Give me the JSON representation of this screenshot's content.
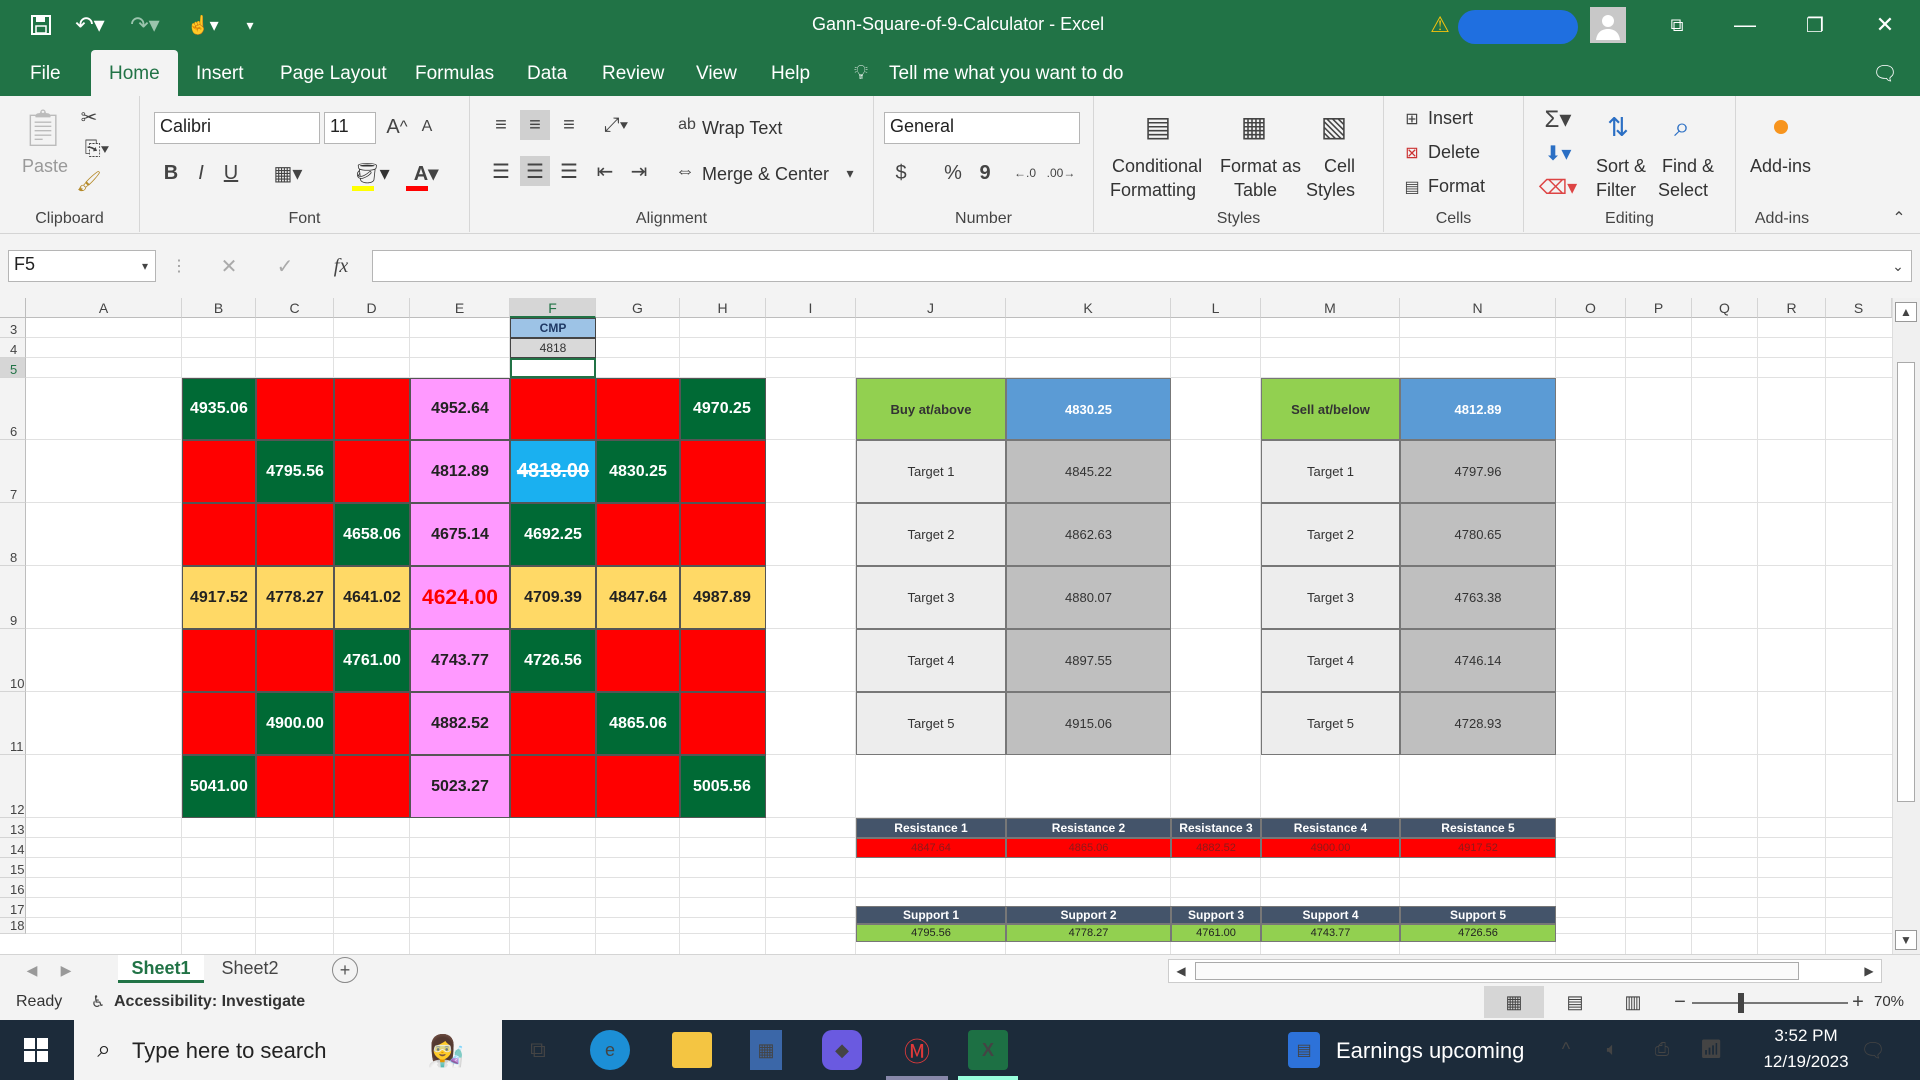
{
  "app": {
    "title": "Gann-Square-of-9-Calculator  -  Excel"
  },
  "tabs": [
    "File",
    "Home",
    "Insert",
    "Page Layout",
    "Formulas",
    "Data",
    "Review",
    "View",
    "Help"
  ],
  "tellme": "Tell me what you want to do",
  "ribbon": {
    "clipboard": {
      "paste": "Paste",
      "label": "Clipboard"
    },
    "font": {
      "name": "Calibri",
      "size": "11",
      "label": "Font",
      "bold": "B",
      "italic": "I",
      "underline": "U"
    },
    "alignment": {
      "wrap": "Wrap Text",
      "merge": "Merge & Center",
      "label": "Alignment"
    },
    "number": {
      "format": "General",
      "label": "Number",
      "currency": "$",
      "percent": "%",
      "comma": "9"
    },
    "styles": {
      "cond1": "Conditional",
      "cond2": "Formatting",
      "fmt1": "Format as",
      "fmt2": "Table",
      "cell1": "Cell",
      "cell2": "Styles",
      "label": "Styles"
    },
    "cells": {
      "insert": "Insert",
      "delete": "Delete",
      "format": "Format",
      "label": "Cells"
    },
    "editing": {
      "sort1": "Sort &",
      "sort2": "Filter",
      "find1": "Find &",
      "find2": "Select",
      "label": "Editing"
    },
    "addins": {
      "btn": "Add-ins",
      "label": "Add-ins"
    }
  },
  "formula_bar": {
    "name_box": "F5",
    "fx": "fx",
    "value": ""
  },
  "columns": [
    "A",
    "B",
    "C",
    "D",
    "E",
    "F",
    "G",
    "H",
    "I",
    "J",
    "K",
    "L",
    "M",
    "N",
    "O",
    "P",
    "Q",
    "R",
    "S"
  ],
  "rows": [
    "3",
    "4",
    "5",
    "6",
    "7",
    "8",
    "9",
    "10",
    "11",
    "12",
    "13",
    "14",
    "15",
    "16",
    "17",
    "18"
  ],
  "cmp": {
    "label": "CMP",
    "value": "4818"
  },
  "gann": [
    [
      "4935.06",
      "",
      "",
      "4952.64",
      "",
      "",
      "4970.25"
    ],
    [
      "",
      "4795.56",
      "",
      "4812.89",
      "4818.00",
      "4830.25",
      ""
    ],
    [
      "",
      "",
      "4658.06",
      "4675.14",
      "4692.25",
      "",
      ""
    ],
    [
      "4917.52",
      "4778.27",
      "4641.02",
      "4624.00",
      "4709.39",
      "4847.64",
      "4987.89"
    ],
    [
      "",
      "",
      "4761.00",
      "4743.77",
      "4726.56",
      "",
      ""
    ],
    [
      "",
      "4900.00",
      "",
      "4882.52",
      "",
      "4865.06",
      ""
    ],
    [
      "5041.00",
      "",
      "",
      "5023.27",
      "",
      "",
      "5005.56"
    ]
  ],
  "gann_colors": {
    "red": "#ff0000",
    "green": "#006a35",
    "pink": "#ff99ff",
    "yellow": "#ffd966",
    "blue": "#1ab0f0"
  },
  "buy": {
    "label": "Buy at/above",
    "value": "4830.25",
    "targets": [
      [
        "Target 1",
        "4845.22"
      ],
      [
        "Target 2",
        "4862.63"
      ],
      [
        "Target 3",
        "4880.07"
      ],
      [
        "Target 4",
        "4897.55"
      ],
      [
        "Target 5",
        "4915.06"
      ]
    ]
  },
  "sell": {
    "label": "Sell at/below",
    "value": "4812.89",
    "targets": [
      [
        "Target 1",
        "4797.96"
      ],
      [
        "Target 2",
        "4780.65"
      ],
      [
        "Target 3",
        "4763.38"
      ],
      [
        "Target 4",
        "4746.14"
      ],
      [
        "Target 5",
        "4728.93"
      ]
    ]
  },
  "resistance": {
    "labels": [
      "Resistance 1",
      "Resistance 2",
      "Resistance 3",
      "Resistance 4",
      "Resistance 5"
    ],
    "values": [
      "4847.64",
      "4865.06",
      "4882.52",
      "4900.00",
      "4917.52"
    ]
  },
  "support": {
    "labels": [
      "Support 1",
      "Support 2",
      "Support 3",
      "Support 4",
      "Support 5"
    ],
    "values": [
      "4795.56",
      "4778.27",
      "4761.00",
      "4743.77",
      "4726.56"
    ]
  },
  "sheets": [
    "Sheet1",
    "Sheet2"
  ],
  "status": {
    "ready": "Ready",
    "access": "Accessibility: Investigate",
    "zoom": "70%"
  },
  "taskbar": {
    "search": "Type here to search",
    "news": "Earnings upcoming",
    "time": "3:52 PM",
    "date": "12/19/2023"
  }
}
